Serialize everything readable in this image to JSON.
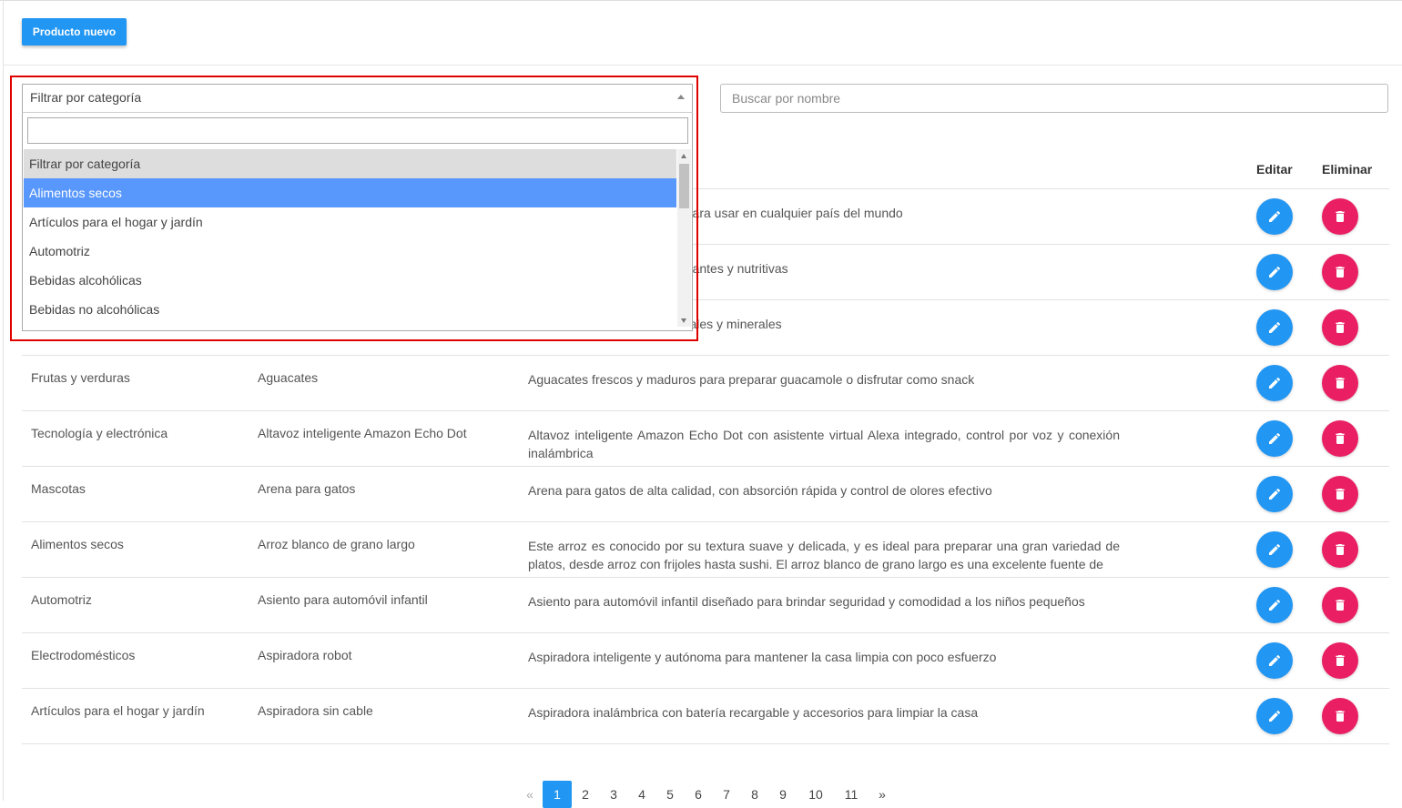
{
  "toolbar": {
    "new_product_label": "Producto nuevo"
  },
  "filter": {
    "selected": "Filtrar por categoría",
    "search_value": "",
    "options": [
      "Filtrar por categoría",
      "Alimentos secos",
      "Artículos para el hogar y jardín",
      "Automotriz",
      "Bebidas alcohólicas",
      "Bebidas no alcohólicas"
    ],
    "highlighted_option": "Alimentos secos"
  },
  "search": {
    "placeholder": "Buscar por nombre",
    "value": ""
  },
  "table": {
    "headers": {
      "edit": "Editar",
      "delete": "Eliminar"
    },
    "rows": [
      {
        "category": "",
        "name": "",
        "description": "rsal con múltiples enchufes para usar en cualquier país del mundo"
      },
      {
        "category": "",
        "name": "",
        "description": "cante con propiedades hidratantes y nutritivas"
      },
      {
        "category": "",
        "name": "",
        "description": "ntial con bajo contenido de sales y minerales"
      },
      {
        "category": "Frutas y verduras",
        "name": "Aguacates",
        "description": "Aguacates frescos y maduros para preparar guacamole o disfrutar como snack"
      },
      {
        "category": "Tecnología y electrónica",
        "name": "Altavoz inteligente Amazon Echo Dot",
        "description": "Altavoz inteligente Amazon Echo Dot con asistente virtual Alexa integrado, control por voz y conexión inalámbrica"
      },
      {
        "category": "Mascotas",
        "name": "Arena para gatos",
        "description": "Arena para gatos de alta calidad, con absorción rápida y control de olores efectivo"
      },
      {
        "category": "Alimentos secos",
        "name": "Arroz blanco de grano largo",
        "description": "Este arroz es conocido por su textura suave y delicada, y es ideal para preparar una gran variedad de platos, desde arroz con frijoles hasta sushi. El arroz blanco de grano largo es una excelente fuente de"
      },
      {
        "category": "Automotriz",
        "name": "Asiento para automóvil infantil",
        "description": "Asiento para automóvil infantil diseñado para brindar seguridad y comodidad a los niños pequeños"
      },
      {
        "category": "Electrodomésticos",
        "name": "Aspiradora robot",
        "description": "Aspiradora inteligente y autónoma para mantener la casa limpia con poco esfuerzo"
      },
      {
        "category": "Artículos para el hogar y jardín",
        "name": "Aspiradora sin cable",
        "description": "Aspiradora inalámbrica con batería recargable y accesorios para limpiar la casa"
      }
    ]
  },
  "pagination": {
    "prev": "«",
    "next": "»",
    "pages": [
      "1",
      "2",
      "3",
      "4",
      "5",
      "6",
      "7",
      "8",
      "9",
      "10",
      "11"
    ],
    "current": "1"
  },
  "colors": {
    "primary": "#2196f3",
    "danger": "#e91e63",
    "highlight_border": "#e00000",
    "option_highlight": "#5897fb"
  },
  "icons": {
    "edit": "pencil-icon",
    "delete": "trash-icon"
  }
}
